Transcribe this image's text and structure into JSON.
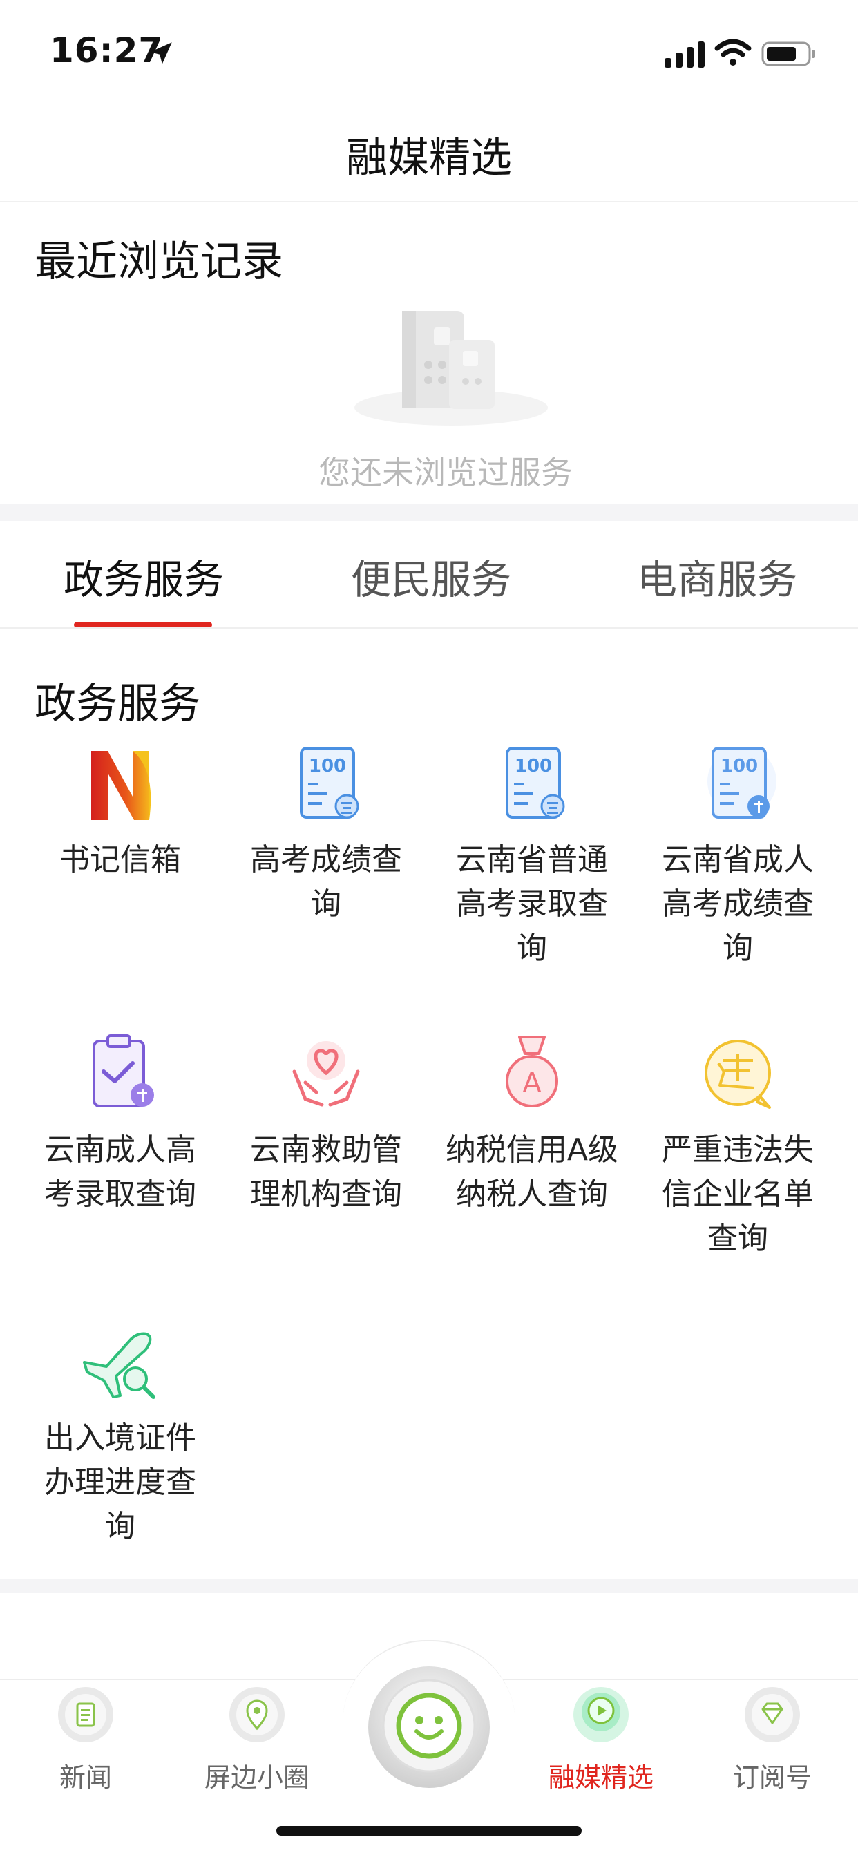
{
  "status_bar": {
    "time": "16:27"
  },
  "header": {
    "title": "融媒精选"
  },
  "recent": {
    "title": "最近浏览记录",
    "empty_text": "您还未浏览过服务"
  },
  "tabs": [
    {
      "label": "政务服务",
      "active": true
    },
    {
      "label": "便民服务",
      "active": false
    },
    {
      "label": "电商服务",
      "active": false
    }
  ],
  "section": {
    "title": "政务服务",
    "items": [
      {
        "label": "书记信箱",
        "icon": "mailbox-logo-icon"
      },
      {
        "label": "高考成绩查询",
        "icon": "score-report-icon"
      },
      {
        "label": "云南省普通高考录取查询",
        "icon": "score-report-icon"
      },
      {
        "label": "云南省成人高考成绩查询",
        "icon": "score-report-icon"
      },
      {
        "label": "云南成人高考录取查询",
        "icon": "clipboard-check-icon"
      },
      {
        "label": "云南救助管理机构查询",
        "icon": "hands-heart-icon"
      },
      {
        "label": "纳税信用A级纳税人查询",
        "icon": "medal-a-icon"
      },
      {
        "label": "严重违法失信企业名单查询",
        "icon": "violation-badge-icon"
      },
      {
        "label": "出入境证件办理进度查询",
        "icon": "plane-search-icon"
      }
    ]
  },
  "tabbar": {
    "items": [
      {
        "label": "新闻",
        "icon": "news-icon",
        "active": false
      },
      {
        "label": "屏边小圈",
        "icon": "location-pin-icon",
        "active": false
      },
      {
        "label": "融媒精选",
        "icon": "play-icon",
        "active": true
      },
      {
        "label": "订阅号",
        "icon": "diamond-icon",
        "active": false
      }
    ],
    "center_icon": "smiley-icon"
  },
  "colors": {
    "accent": "#e0261f",
    "blue_icon": "#4a90e2",
    "purple_icon": "#7b5cd6",
    "pink_icon": "#f06f7a",
    "yellow_icon": "#f2c230",
    "green_icon": "#2fbf7a"
  }
}
